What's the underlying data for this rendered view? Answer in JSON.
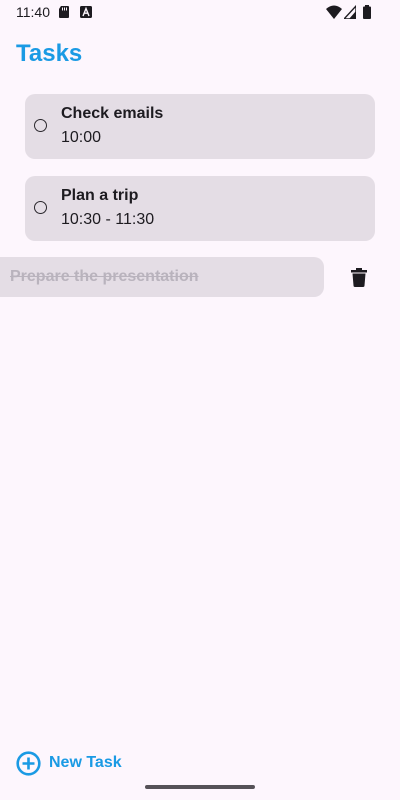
{
  "status_bar": {
    "time": "11:40",
    "icons": [
      "sd-card-icon",
      "a-icon",
      "wifi-icon",
      "signal-icon",
      "battery-icon"
    ]
  },
  "header": {
    "title": "Tasks"
  },
  "tasks": [
    {
      "title": "Check emails",
      "time": "10:00",
      "completed": false
    },
    {
      "title": "Plan a trip",
      "time": "10:30 - 11:30",
      "completed": false
    }
  ],
  "swiped_task": {
    "title": "Prepare the presentation",
    "completed": true,
    "action_icon": "delete-icon"
  },
  "footer": {
    "new_task_label": "New Task",
    "new_task_icon": "add-circle-icon"
  },
  "colors": {
    "accent": "#1a9ae4",
    "background": "#fdf6fd",
    "card": "#e4dde5",
    "text": "#1d1b20",
    "muted_text": "#b9b3bd"
  }
}
